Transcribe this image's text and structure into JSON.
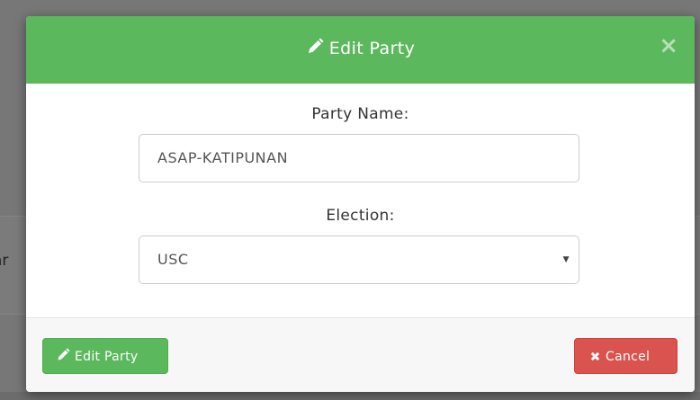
{
  "background": {
    "partial_text": "ar"
  },
  "modal": {
    "title": "Edit Party",
    "close_glyph": "×",
    "header_color": "#5cb85c",
    "fields": {
      "party_name_label": "Party Name:",
      "party_name_value": "ASAP-KATIPUNAN",
      "election_label": "Election:",
      "election_value": "USC"
    },
    "footer": {
      "edit_button_label": "Edit Party",
      "cancel_button_label": "Cancel",
      "edit_button_color": "#5cb85c",
      "cancel_button_color": "#d9534f"
    },
    "icons": {
      "title_icon": "pencil-icon",
      "edit_button_icon": "pencil-icon",
      "cancel_button_icon": "times-icon",
      "select_icon": "caret-down-icon"
    }
  }
}
